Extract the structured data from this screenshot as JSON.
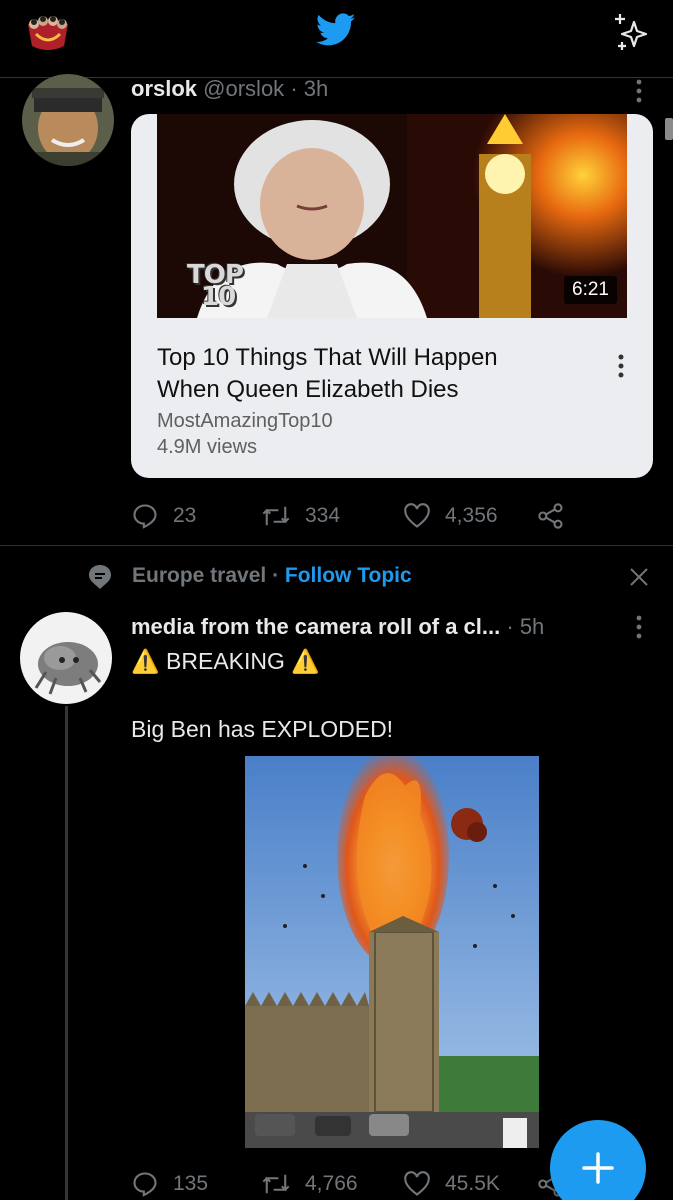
{
  "header": {
    "logo_icon": "twitter-bird-icon",
    "sparkle_icon": "sparkle-icon",
    "accent_color": "#1d9bf0"
  },
  "tweets": [
    {
      "display_name": "orslok",
      "handle": "@orslok",
      "separator": "·",
      "time": "3h",
      "card": {
        "title_line1": "Top 10 Things That Will Happen",
        "title_line2": "When Queen Elizabeth Dies",
        "channel": "MostAmazingTop10",
        "views": "4.9M views",
        "duration": "6:21",
        "thumb_text_1": "TOP",
        "thumb_text_2": "10"
      },
      "replies": "23",
      "retweets": "334",
      "likes": "4,356"
    },
    {
      "display_name": "media from the camera roll of a cl...",
      "separator": "·",
      "time": "5h",
      "text_line1": "⚠️ BREAKING ⚠️",
      "text_line2": "Big Ben has EXPLODED!",
      "replies": "135",
      "retweets": "4,766",
      "likes": "45.5K"
    }
  ],
  "topic": {
    "name": "Europe travel",
    "separator": "·",
    "follow_label": "Follow Topic"
  },
  "fab": {
    "icon": "plus-icon"
  }
}
